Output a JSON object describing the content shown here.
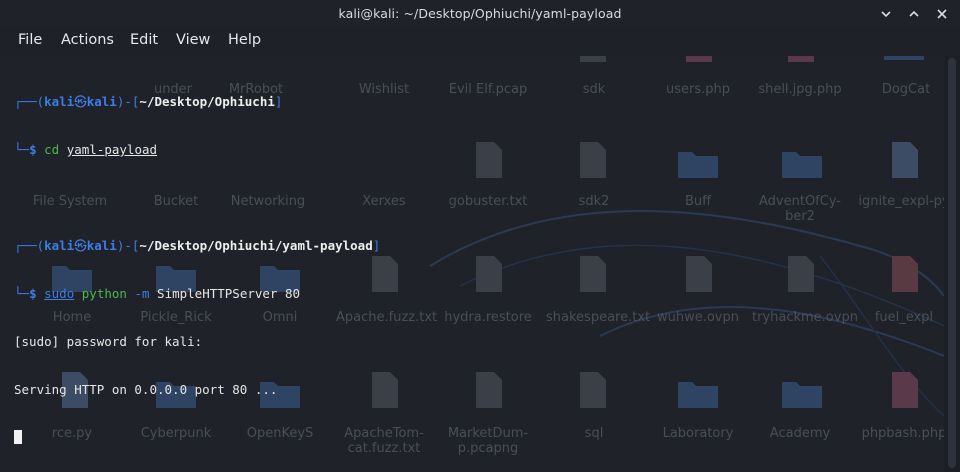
{
  "window": {
    "title": "kali@kali: ~/Desktop/Ophiuchi/yaml-payload"
  },
  "menu": [
    "File",
    "Actions",
    "Edit",
    "View",
    "Help"
  ],
  "terminal": {
    "prompt1": {
      "open": "┌──(",
      "user": "kali",
      "at": "㉿",
      "host": "kali",
      "mid": ")-[",
      "path": "~/Desktop/Ophiuchi",
      "close": "]",
      "cmd_prefix": "└─",
      "dollar": "$",
      "cmd": "cd",
      "arg": "yaml-payload"
    },
    "prompt2": {
      "open": "┌──(",
      "user": "kali",
      "at": "㉿",
      "host": "kali",
      "mid": ")-[",
      "path": "~/Desktop/Ophiuchi/yaml-payload",
      "close": "]",
      "cmd_prefix": "└─",
      "dollar": "$",
      "cmd": "sudo",
      "word2": "python",
      "flag": "-m",
      "rest": "SimpleHTTPServer 80"
    },
    "output": [
      "[sudo] password for kali:",
      "Serving HTTP on 0.0.0.0 port 80 ..."
    ]
  },
  "desktop_icons": {
    "row1": [
      "under",
      "MrRobot",
      "Wishlist",
      "Evil Elf.pcap",
      "sdk",
      "users.php",
      "shell.jpg.php",
      "DogCat"
    ],
    "row2": [
      "File System",
      "Bucket",
      "Networking",
      "Xerxes",
      "gobuster.txt",
      "sdk2",
      "Buff",
      "AdventOfCy-ber2",
      "ignite_expl-py"
    ],
    "row3": [
      "Home",
      "Pickle_Rick",
      "Omni",
      "Apache.fuzz.txt",
      "hydra.restore",
      "shakespeare.txt",
      "wuhwe.ovpn",
      "tryhackme.ovpn",
      "fuel_expl"
    ],
    "row4": [
      "rce.py",
      "Cyberpunk",
      "OpenKeyS",
      "ApacheTom-cat.fuzz.txt",
      "MarketDum-p.pcapng",
      "sql",
      "Laboratory",
      "Academy",
      "phpbash.php"
    ]
  }
}
